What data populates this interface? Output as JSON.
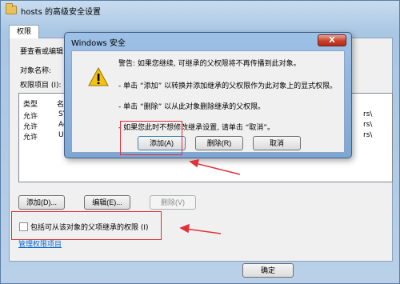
{
  "window": {
    "title": "hosts 的高级安全设置",
    "tab": "权限",
    "intro": "要查看或编辑",
    "object_name_label": "对象名称:",
    "permissions_label": "权限项目 (I):",
    "columns": [
      "类型",
      "名"
    ],
    "rows": [
      {
        "type": "允许",
        "name": "SY",
        "tail": "rs\\"
      },
      {
        "type": "允许",
        "name": "Ad",
        "tail": "rs\\"
      },
      {
        "type": "允许",
        "name": "Us",
        "tail": "rs\\"
      }
    ],
    "buttons": {
      "add": "添加(D)...",
      "edit": "编辑(E)...",
      "remove": "删除(V)"
    },
    "checkbox_label": "包括可从该对象的父项继承的权限 (I)",
    "checkbox_checked": false,
    "manage_link": "管理权限项目",
    "ok": "确定"
  },
  "dialog": {
    "title": "Windows 安全",
    "close": "X",
    "icon": "warning-icon",
    "messages": [
      "警告: 如果您继续, 可继承的父权限将不再传播到此对象。",
      "- 单击 “添加” 以转换并添加继承的父权限作为此对象上的显式权限。",
      "- 单击 “删除” 以从此对象删除继承的父权限。",
      "- 如果您此时不想修改继承设置, 请单击 “取消”。"
    ],
    "buttons": {
      "add": "添加(A)",
      "remove": "删除(R)",
      "cancel": "取消"
    }
  },
  "colors": {
    "annotation": "#e0303a",
    "accent": "#0066cc"
  }
}
